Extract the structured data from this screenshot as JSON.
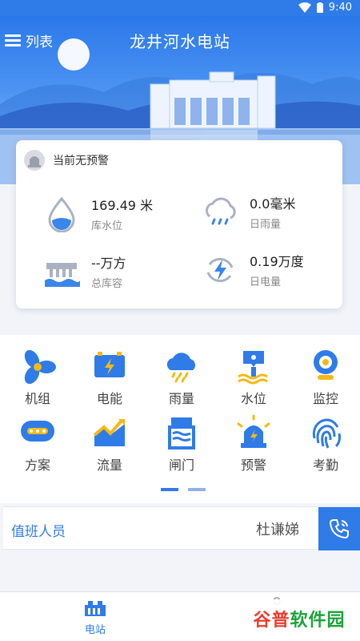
{
  "status_bar": {
    "time": "9:40"
  },
  "header": {
    "list_label": "列表",
    "title": "龙井河水电站"
  },
  "alert_card": {
    "status": "当前无预警",
    "metrics": [
      {
        "value": "169.49 米",
        "label": "库水位",
        "icon": "water-drop-icon"
      },
      {
        "value": "0.0毫米",
        "label": "日雨量",
        "icon": "rain-cloud-icon"
      },
      {
        "value": "--万方",
        "label": "总库容",
        "icon": "reservoir-icon"
      },
      {
        "value": "0.19万度",
        "label": "日电量",
        "icon": "power-cycle-icon"
      }
    ]
  },
  "menu": {
    "items": [
      {
        "label": "机组",
        "icon": "fan-icon"
      },
      {
        "label": "电能",
        "icon": "battery-icon"
      },
      {
        "label": "雨量",
        "icon": "rain-cloud-icon"
      },
      {
        "label": "水位",
        "icon": "water-gauge-icon"
      },
      {
        "label": "监控",
        "icon": "camera-icon"
      },
      {
        "label": "方案",
        "icon": "plan-icon"
      },
      {
        "label": "流量",
        "icon": "trend-chart-icon"
      },
      {
        "label": "闸门",
        "icon": "gate-icon"
      },
      {
        "label": "预警",
        "icon": "alarm-light-icon"
      },
      {
        "label": "考勤",
        "icon": "fingerprint-icon"
      }
    ],
    "page_indicator": {
      "pages": 2,
      "active": 1
    }
  },
  "duty": {
    "label": "值班人员",
    "name": "杜谦娣"
  },
  "bottom_nav": {
    "items": [
      {
        "label": "电站",
        "active": true
      }
    ]
  },
  "watermark": {
    "text_a": "谷普",
    "text_b": "软件园"
  },
  "colors": {
    "primary": "#2f7be8",
    "accent_yellow": "#f5b916",
    "text_dark": "#222222"
  }
}
